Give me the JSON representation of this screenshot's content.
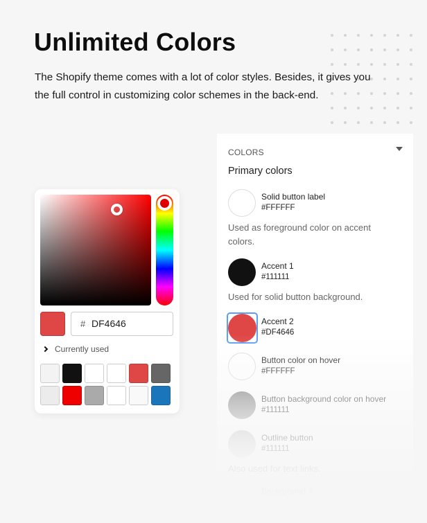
{
  "hero": {
    "title": "Unlimited Colors",
    "description": "The Shopify theme comes with a lot of color styles. Besides, it gives you the full control in customizing color schemes in the back-end."
  },
  "settings_panel": {
    "header_label": "COLORS",
    "header_icon": "caret-down-icon",
    "section_title": "Primary colors",
    "items": [
      {
        "label": "Solid button label",
        "hex": "#FFFFFF",
        "color": "#ffffff",
        "note": "Used as foreground color on accent colors.",
        "selected": false
      },
      {
        "label": "Accent 1",
        "hex": "#111111",
        "color": "#111111",
        "note": "Used for solid button background.",
        "selected": false
      },
      {
        "label": "Accent 2",
        "hex": "#DF4646",
        "color": "#df4646",
        "note": "",
        "selected": true
      },
      {
        "label": "Button color on hover",
        "hex": "#FFFFFF",
        "color": "#ffffff",
        "note": "",
        "selected": false
      },
      {
        "label": "Button background color on hover",
        "hex": "#111111",
        "color": "#111111",
        "note": "",
        "selected": false
      },
      {
        "label": "Outline button",
        "hex": "#111111",
        "color": "#111111",
        "note": "Also used for text links.",
        "selected": false
      },
      {
        "label": "Background 1",
        "hex": "",
        "color": "#ffffff",
        "note": "",
        "selected": false
      }
    ]
  },
  "color_picker": {
    "current_color": "#df4646",
    "hue_color": "#ff0000",
    "hex_prefix": "#",
    "hex_value": "DF4646",
    "recent_toggle_label": "Currently used",
    "recent_toggle_icon": "chevron-right-icon",
    "recent_colors": [
      "#f3f3f3",
      "#111111",
      "#ffffff",
      "#ffffff",
      "#df4646",
      "#666666",
      "#ececec",
      "#ee0000",
      "#aaaaaa",
      "#ffffff",
      "#f9f9f9",
      "#1a75bb"
    ]
  },
  "decor": {
    "dot_grid": "dot-grid-decoration"
  }
}
